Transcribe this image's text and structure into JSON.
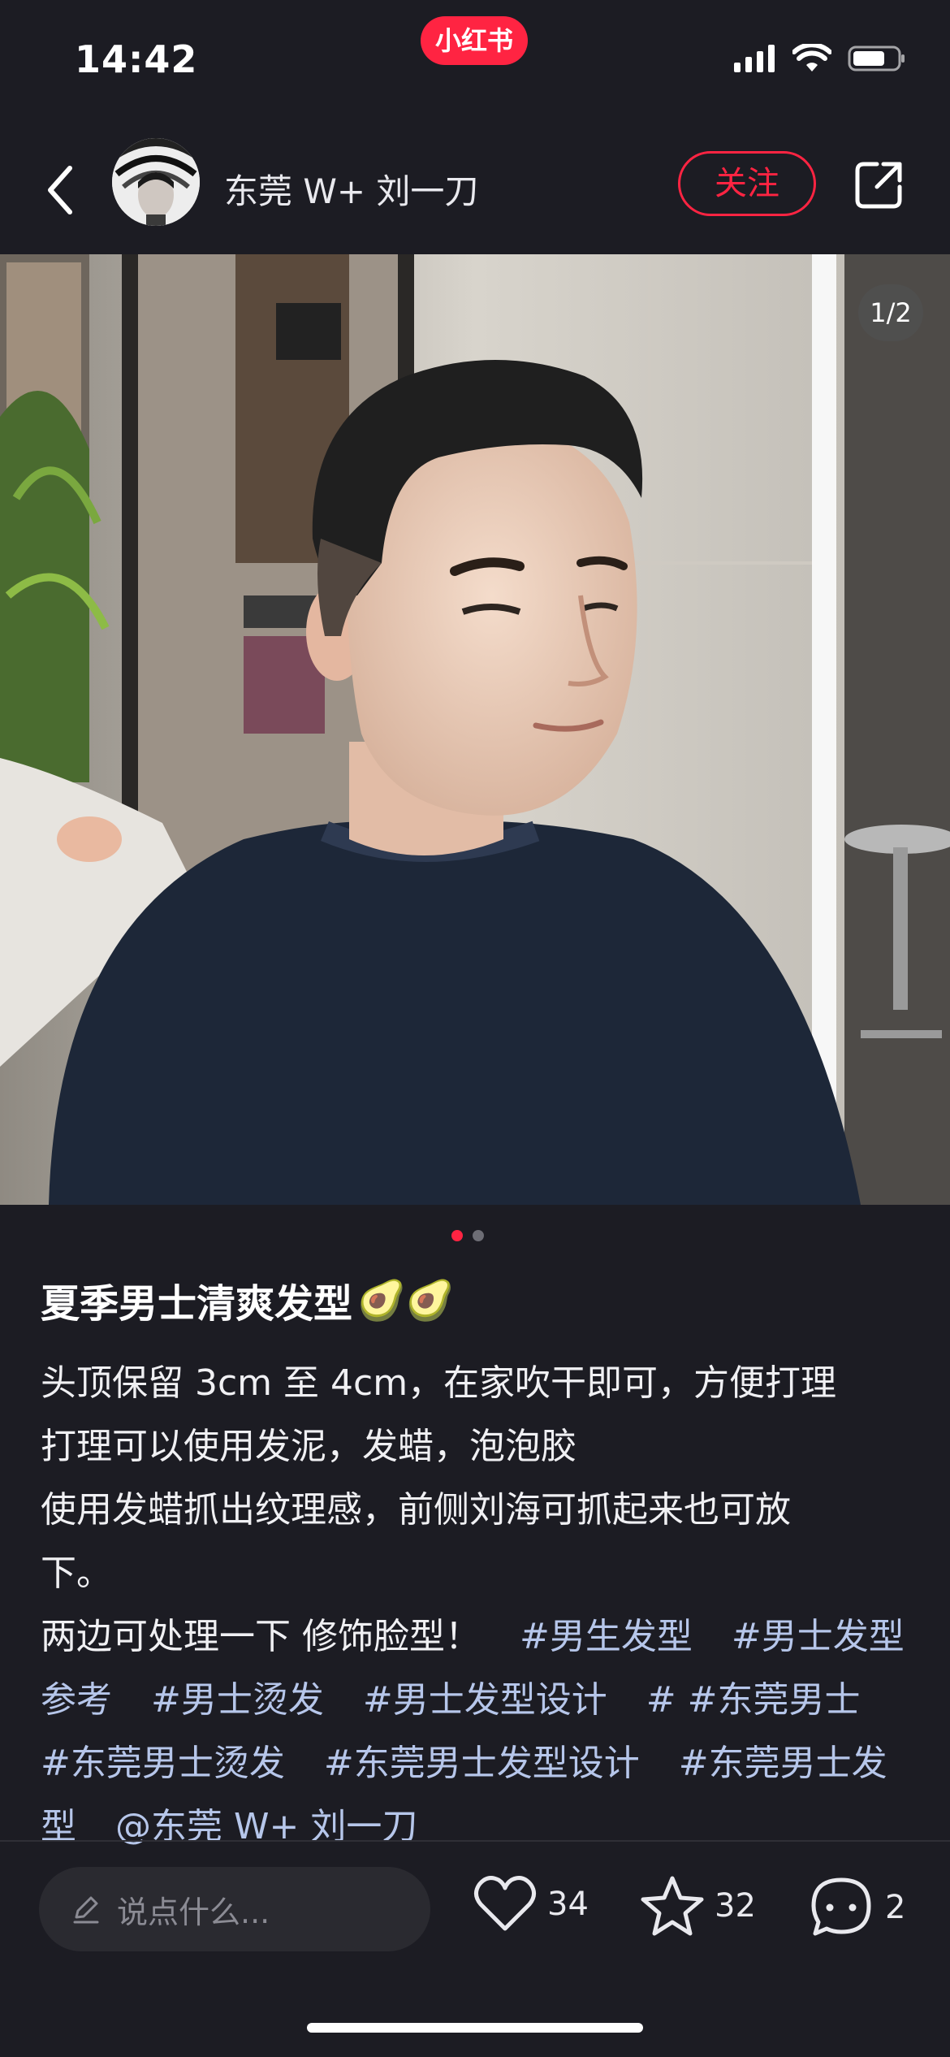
{
  "status_bar": {
    "time": "14:42",
    "app_badge": "小红书"
  },
  "nav": {
    "author_name": "东莞 W+ 刘一刀",
    "follow_label": "关注"
  },
  "image": {
    "counter": "1/2",
    "description": "man with short textured haircut in salon"
  },
  "post": {
    "title": "夏季男士清爽发型",
    "title_emoji": "🥑🥑",
    "lines": [
      "头顶保留 3cm 至 4cm，在家吹干即可，方便打理",
      "打理可以使用发泥，发蜡，泡泡胶",
      "使用发蜡抓出纹理感，前侧刘海可抓起来也可放",
      "下。"
    ],
    "last_line_prefix": "两边可处理一下 修饰脸型！",
    "tags": [
      "#男生发型",
      "#男士发型参考",
      "#男士烫发",
      "#男士发型设计",
      "# #东莞男士",
      "#东莞男士烫发",
      "#东莞男士发型设计",
      "#东莞男士发型",
      "@东莞 W+ 刘一刀"
    ]
  },
  "bottom_bar": {
    "comment_placeholder": "说点什么...",
    "likes": "34",
    "collects": "32",
    "comments": "2"
  },
  "colors": {
    "accent": "#ff2442",
    "background": "#1c1c23",
    "tag": "#b6c6ea"
  }
}
